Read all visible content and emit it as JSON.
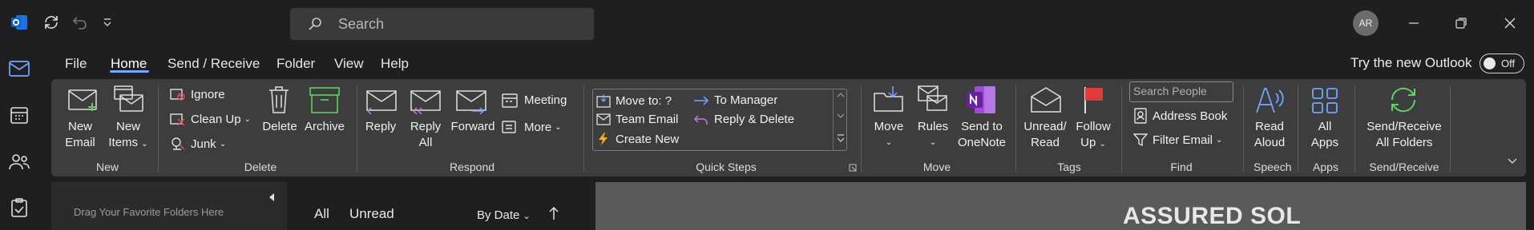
{
  "titlebar": {
    "search_placeholder": "Search",
    "avatar_initials": "AR"
  },
  "menu": {
    "tabs": [
      "File",
      "Home",
      "Send / Receive",
      "Folder",
      "View",
      "Help"
    ],
    "active_tab": "Home",
    "try_new_outlook": "Try the new Outlook",
    "toggle_state": "Off"
  },
  "ribbon": {
    "new": {
      "new_email": [
        "New",
        "Email"
      ],
      "new_items": [
        "New",
        "Items"
      ],
      "group": "New"
    },
    "delete": {
      "ignore": "Ignore",
      "clean_up": "Clean Up",
      "junk": "Junk",
      "delete": "Delete",
      "archive": "Archive",
      "group": "Delete"
    },
    "respond": {
      "reply": "Reply",
      "reply_all": [
        "Reply",
        "All"
      ],
      "forward": "Forward",
      "meeting": "Meeting",
      "more": "More",
      "group": "Respond"
    },
    "quick_steps": {
      "items": [
        "Move to: ?",
        "Team Email",
        "Create New",
        "To Manager",
        "Reply & Delete"
      ],
      "group": "Quick Steps"
    },
    "move": {
      "move": "Move",
      "rules": "Rules",
      "send_to_onenote": [
        "Send to",
        "OneNote"
      ],
      "group": "Move"
    },
    "tags": {
      "unread_read": [
        "Unread/",
        "Read"
      ],
      "follow_up": [
        "Follow",
        "Up"
      ],
      "group": "Tags"
    },
    "find": {
      "search_people": "Search People",
      "address_book": "Address Book",
      "filter_email": "Filter Email",
      "group": "Find"
    },
    "speech": {
      "read_aloud": [
        "Read",
        "Aloud"
      ],
      "group": "Speech"
    },
    "apps": {
      "all_apps": [
        "All",
        "Apps"
      ],
      "group": "Apps"
    },
    "send_receive": {
      "label": [
        "Send/Receive",
        "All Folders"
      ],
      "group": "Send/Receive"
    }
  },
  "folder_pane": {
    "hint": "Drag Your Favorite Folders Here"
  },
  "message_list": {
    "filter_all": "All",
    "filter_unread": "Unread",
    "sort": "By Date"
  },
  "reading_pane": {
    "brand_text": "ASSURED SOL"
  },
  "colors": {
    "accent": "#6ea8ff",
    "ribbon_bg": "#3d3d3d",
    "window_bg": "#1f1f1f",
    "reading_bg": "#5a5a5a"
  }
}
